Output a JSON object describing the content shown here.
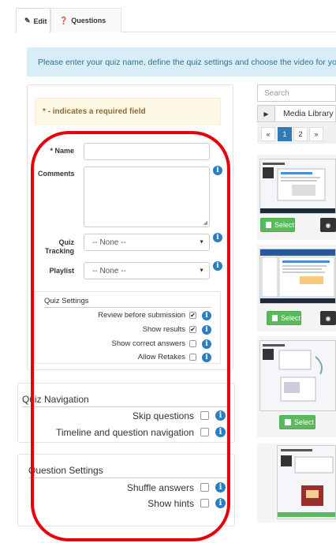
{
  "tabs": [
    {
      "label": "Edit",
      "icon": "pencil-icon",
      "active": true
    },
    {
      "label": "Questions",
      "icon": "question-circle-icon",
      "active": false
    }
  ],
  "alert": {
    "text": "Please enter your quiz name, define the quiz settings and choose the video for your quiz."
  },
  "form": {
    "required_note": "* - indicates a required field",
    "name_label": "* Name",
    "name_value": "",
    "comments_label": "Comments",
    "comments_value": "",
    "quiz_tracking_label_1": "Quiz",
    "quiz_tracking_label_2": "Tracking",
    "quiz_tracking_value": "-- None --",
    "playlist_label": "Playlist",
    "playlist_value": "-- None --",
    "info_glyph": "i"
  },
  "quiz_settings": {
    "legend": "Quiz Settings",
    "options": [
      {
        "label": "Review before submission",
        "checked": true
      },
      {
        "label": "Show results",
        "checked": true
      },
      {
        "label": "Show correct answers",
        "checked": false
      },
      {
        "label": "Allow Retakes",
        "checked": false
      }
    ]
  },
  "quiz_navigation": {
    "legend": "Quiz Navigation",
    "options": [
      {
        "label": "Skip questions",
        "checked": false
      },
      {
        "label": "Timeline and question navigation",
        "checked": false
      }
    ]
  },
  "question_settings": {
    "legend": "Question Settings",
    "options": [
      {
        "label": "Shuffle answers",
        "checked": false
      },
      {
        "label": "Show hints",
        "checked": false
      }
    ]
  },
  "media": {
    "search_placeholder": "Search",
    "library_label": "Media Library",
    "pages": [
      "«",
      "1",
      "2",
      "»"
    ],
    "active_page": "1",
    "select_label": "Select"
  },
  "colors": {
    "accent": "#2a7ec2",
    "alert_bg": "#d9edf7",
    "warn_bg": "#fcf8e3",
    "select_green": "#5cb85c",
    "highlight_red": "#e8000b"
  }
}
